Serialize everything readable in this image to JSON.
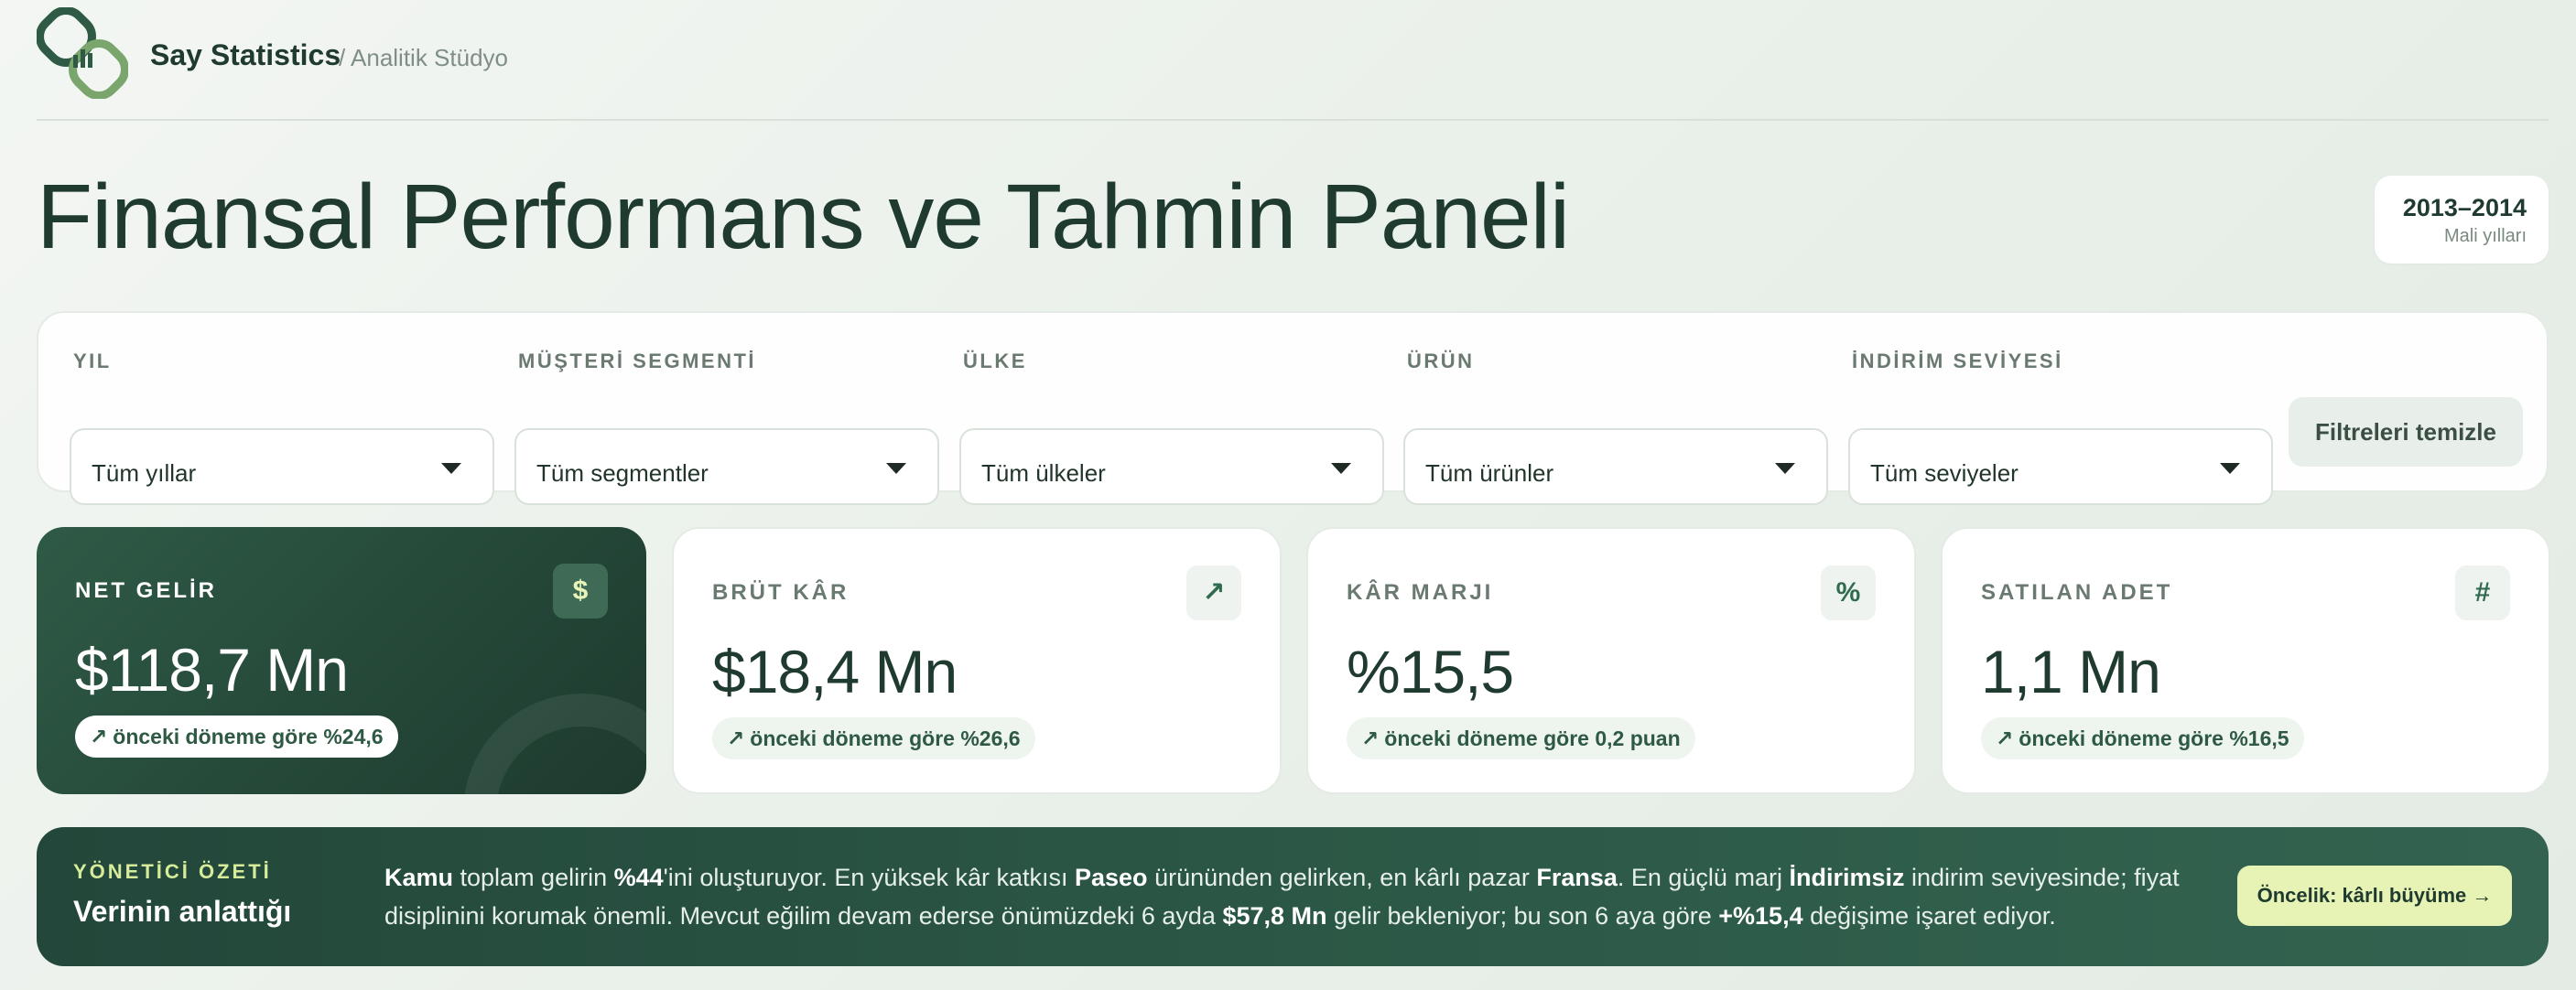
{
  "brand": {
    "name": "Say Statistics",
    "sub": "/ Analitik Stüdyo"
  },
  "page_title": "Finansal Performans ve Tahmin Paneli",
  "period": {
    "range": "2013–2014",
    "label": "Mali yılları"
  },
  "filters": [
    {
      "label": "YIL",
      "value": "Tüm yıllar"
    },
    {
      "label": "MÜŞTERİ SEGMENTİ",
      "value": "Tüm segmentler"
    },
    {
      "label": "ÜLKE",
      "value": "Tüm ülkeler"
    },
    {
      "label": "ÜRÜN",
      "value": "Tüm ürünler"
    },
    {
      "label": "İNDİRİM SEVİYESİ",
      "value": "Tüm seviyeler"
    }
  ],
  "clear_filters": "Filtreleri temizle",
  "kpis": [
    {
      "label": "NET GELİR",
      "icon": "$",
      "value": "$118,7 Mn",
      "change": "önceki döneme göre %24,6"
    },
    {
      "label": "BRÜT KÂR",
      "icon": "↗",
      "value": "$18,4 Mn",
      "change": "önceki döneme göre %26,6"
    },
    {
      "label": "KÂR MARJI",
      "icon": "%",
      "value": "%15,5",
      "change": "önceki döneme göre 0,2 puan"
    },
    {
      "label": "SATILAN ADET",
      "icon": "#",
      "value": "1,1 Mn",
      "change": "önceki döneme göre %16,5"
    }
  ],
  "summary": {
    "kicker": "YÖNETİCİ ÖZETİ",
    "title": "Verinin anlattığı",
    "parts": [
      {
        "t": "Kamu",
        "b": true
      },
      {
        "t": " toplam gelirin ",
        "b": false
      },
      {
        "t": "%44",
        "b": true
      },
      {
        "t": "'ini oluşturuyor. En yüksek kâr katkısı ",
        "b": false
      },
      {
        "t": "Paseo",
        "b": true
      },
      {
        "t": " ürününden gelirken, en kârlı pazar ",
        "b": false
      },
      {
        "t": "Fransa",
        "b": true
      },
      {
        "t": ". En güçlü marj ",
        "b": false
      },
      {
        "t": "İndirimsiz",
        "b": true
      },
      {
        "t": " indirim seviyesinde; fiyat disiplinini korumak önemli. Mevcut eğilim devam ederse önümüzdeki 6 ayda ",
        "b": false
      },
      {
        "t": "$57,8 Mn",
        "b": true
      },
      {
        "t": " gelir bekleniyor; bu son 6 aya göre ",
        "b": false
      },
      {
        "t": "+%15,4",
        "b": true
      },
      {
        "t": " değişime işaret ediyor.",
        "b": false
      }
    ],
    "cta": "Öncelik: kârlı büyüme →"
  },
  "colors": {
    "primary": "#1f3a2e",
    "accent": "#e7f3b4",
    "logo": "#7aa66e"
  }
}
